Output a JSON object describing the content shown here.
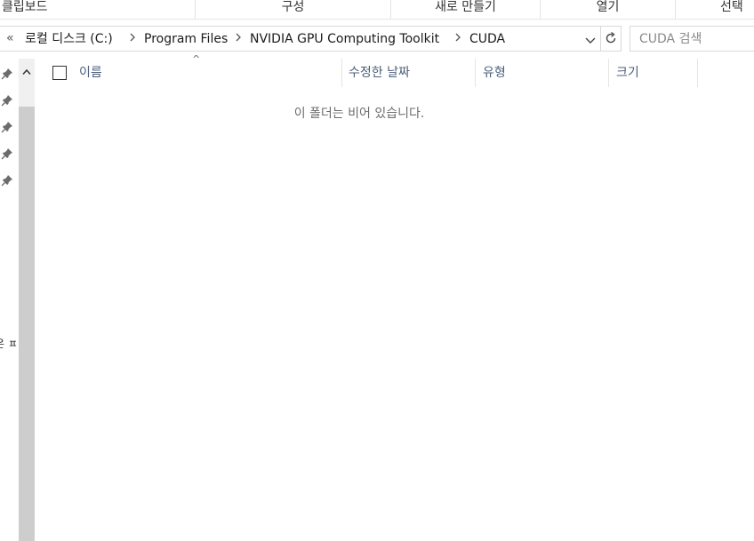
{
  "ribbon": {
    "groups": [
      {
        "label": "클립보드"
      },
      {
        "label": "구성"
      },
      {
        "label": "새로 만들기"
      },
      {
        "label": "열기"
      },
      {
        "label": "선택"
      }
    ]
  },
  "address_bar": {
    "overflow_icon": "«",
    "breadcrumbs": [
      {
        "label": "로컬 디스크 (C:)"
      },
      {
        "label": "Program Files"
      },
      {
        "label": "NVIDIA GPU Computing Toolkit"
      },
      {
        "label": "CUDA"
      }
    ],
    "separator_icon": "chevron-right-icon",
    "dropdown_icon": "chevron-down-icon",
    "refresh_icon": "refresh-icon"
  },
  "search": {
    "placeholder": "CUDA 검색"
  },
  "nav_pane": {
    "pinned_items_count": 5,
    "pin_icon": "pin-icon",
    "cut_text": "은 ㅍ"
  },
  "columns": {
    "name": "이름",
    "date_modified": "수정한 날짜",
    "type": "유형",
    "size": "크기"
  },
  "content": {
    "empty_message": "이 폴더는 비어 있습니다."
  }
}
